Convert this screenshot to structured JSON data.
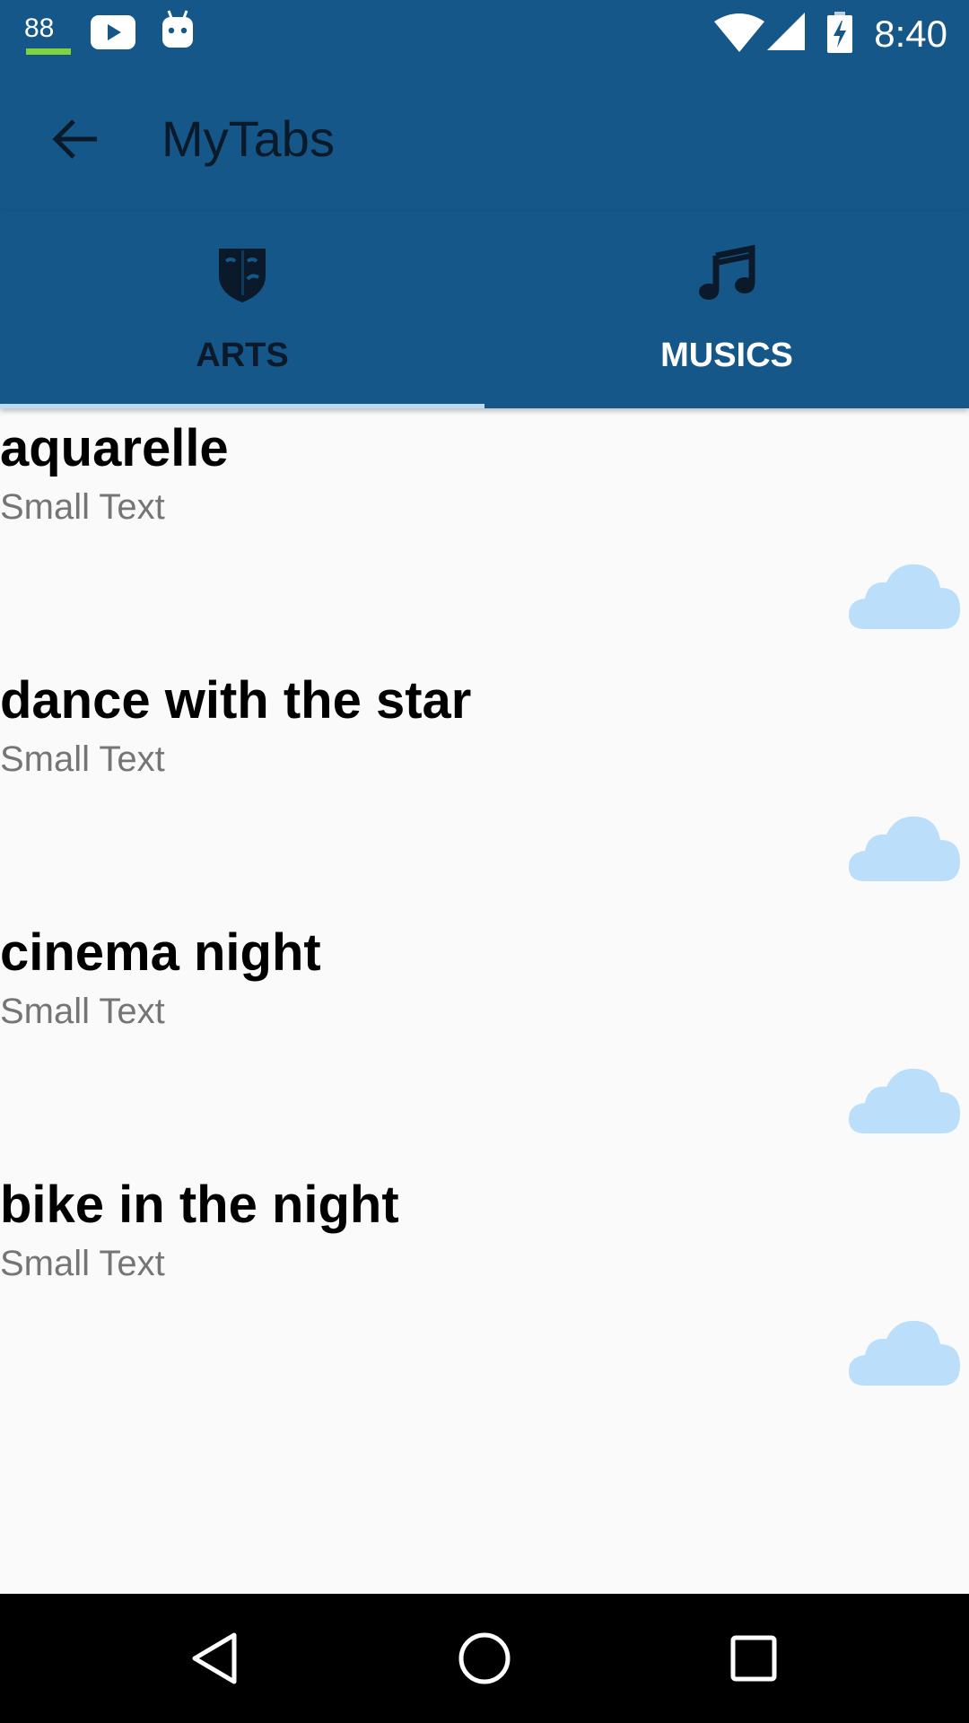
{
  "status_bar": {
    "notification_count": "88",
    "time": "8:40",
    "icons": [
      "youtube-icon",
      "android-icon",
      "wifi-icon",
      "signal-icon",
      "battery-charging-icon"
    ],
    "accent_color": "#7FD33C"
  },
  "app_bar": {
    "title": "MyTabs",
    "back_icon": "arrow-back-icon",
    "background_color": "#155788"
  },
  "tabs": [
    {
      "label": "ARTS",
      "icon": "theater-mask-icon",
      "selected": true
    },
    {
      "label": "MUSICS",
      "icon": "music-note-icon",
      "selected": false
    }
  ],
  "list": {
    "items": [
      {
        "title": "aquarelle",
        "subtitle": "Small Text",
        "icon": "cloud-icon"
      },
      {
        "title": "dance with the star",
        "subtitle": "Small Text",
        "icon": "cloud-icon"
      },
      {
        "title": "cinema night",
        "subtitle": "Small Text",
        "icon": "cloud-icon"
      },
      {
        "title": "bike in the night",
        "subtitle": "Small Text",
        "icon": "cloud-icon"
      }
    ]
  },
  "nav_bar": {
    "buttons": [
      "back-triangle-icon",
      "home-circle-icon",
      "recents-square-icon"
    ]
  }
}
